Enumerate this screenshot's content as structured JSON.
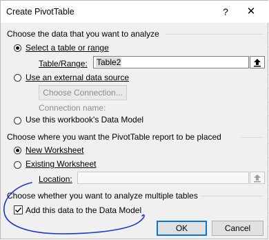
{
  "dialog": {
    "title": "Create PivotTable",
    "help_glyph": "?",
    "close_glyph": "✕"
  },
  "section_data": {
    "heading": "Choose the data that you want to analyze",
    "select_table_label": "Select a table or range",
    "table_range_label": "Table/Range:",
    "table_range_value": "Table2",
    "external_source_label": "Use an external data source",
    "choose_connection_label": "Choose Connection...",
    "connection_name_label": "Connection name:",
    "data_model_label": "Use this workbook's Data Model"
  },
  "section_placement": {
    "heading": "Choose where you want the PivotTable report to be placed",
    "new_worksheet_label": "New Worksheet",
    "existing_worksheet_label": "Existing Worksheet",
    "location_label": "Location:",
    "location_value": ""
  },
  "section_multiple": {
    "heading": "Choose whether you want to analyze multiple tables",
    "add_data_model_label": "Add this data to the Data Model",
    "add_data_model_checked": true
  },
  "buttons": {
    "ok_label": "OK",
    "cancel_label": "Cancel"
  },
  "colors": {
    "dialog_bg": "#f0f0f0",
    "default_button_border": "#0078d7",
    "ink": "#1a35c9"
  },
  "icons": {
    "range_picker": "collapse-dialog-icon",
    "check": "checkmark-icon"
  }
}
